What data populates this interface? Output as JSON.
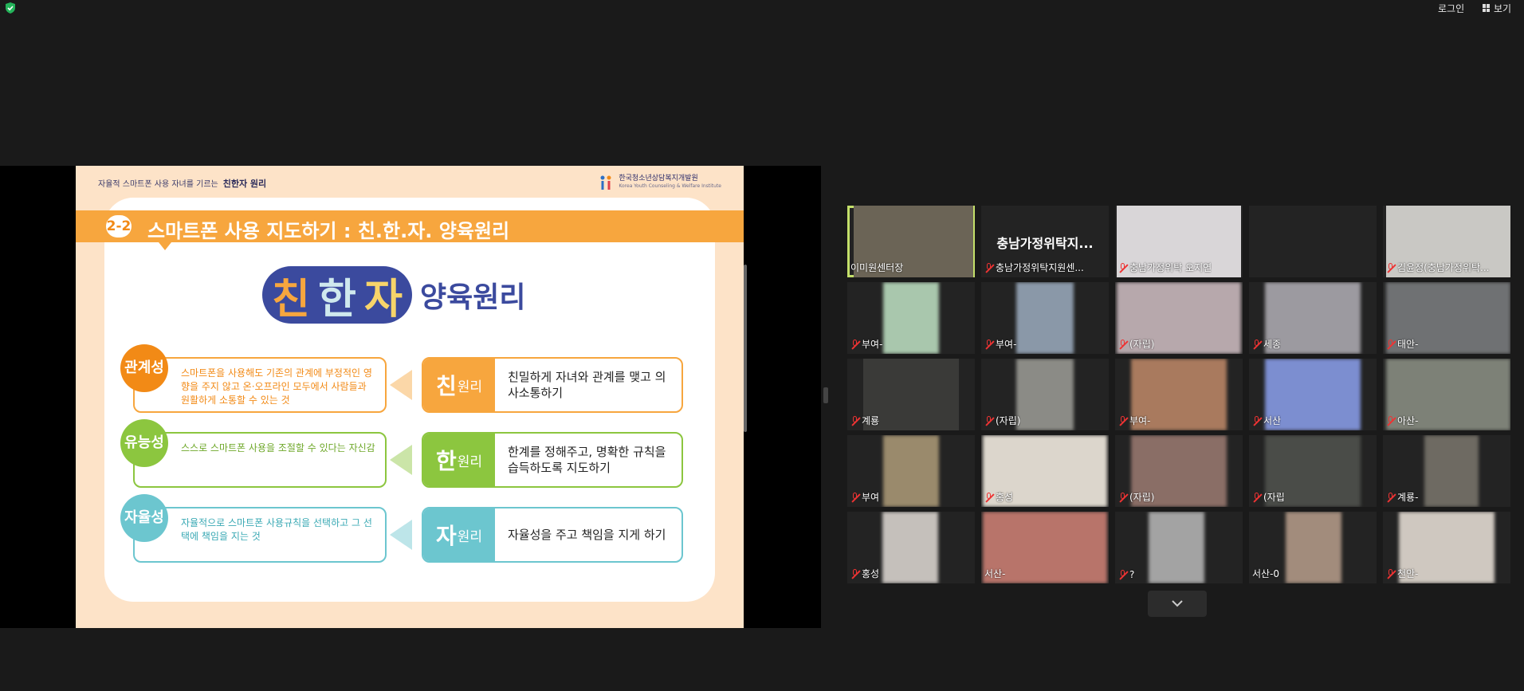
{
  "topbar": {
    "login_label": "로그인",
    "view_label": "보기"
  },
  "slide": {
    "subtitle": "자율적 스마트폰 사용 자녀를 기르는",
    "subtitle_bold": "친한자 원리",
    "institute": "한국청소년상담복지개발원",
    "institute_en": "Korea Youth Counseling & Welfare Institute",
    "section_no": "2-2",
    "title": "스마트폰 사용 지도하기 : 친.한.자. 양육원리",
    "hero_chars": [
      "친",
      "한",
      "자"
    ],
    "hero_suffix": "양육원리",
    "rows": [
      {
        "badge": "관계성",
        "text": "스마트폰을 사용해도 기존의 관계에 부정적인 영향을 주지 않고 온·오프라인 모두에서 사람들과 원활하게 소통할 수 있는 것",
        "tag_char": "친",
        "tag_word": "원리",
        "desc": "친밀하게 자녀와 관계를 맺고 의사소통하기"
      },
      {
        "badge": "유능성",
        "text": "스스로 스마트폰 사용을 조절할 수 있다는 자신감",
        "tag_char": "한",
        "tag_word": "원리",
        "desc": "한계를 정해주고, 명확한 규칙을 습득하도록 지도하기"
      },
      {
        "badge": "자율성",
        "text": "자율적으로 스마트폰 사용규칙을 선택하고 그 선택에 책임을 지는 것",
        "tag_char": "자",
        "tag_word": "원리",
        "desc": "자율성을 주고 책임을 지게 하기"
      }
    ]
  },
  "colors": {
    "orange": "#f7a63e",
    "green": "#8cc63f",
    "teal": "#6cc6cf",
    "navy": "#3b4a9e",
    "active_border": "#c4e06a",
    "mic_muted": "#e33333"
  },
  "participants": [
    {
      "name": "이미원센터장",
      "muted": false,
      "active": true
    },
    {
      "name": "충남가정위탁지원센...",
      "muted": true,
      "big": "충남가정위탁지..."
    },
    {
      "name": "충남가정위탁 오지연",
      "muted": true
    },
    {
      "name": "",
      "muted": false,
      "big": ""
    },
    {
      "name": "김윤정(충남가정위탁...",
      "muted": true
    },
    {
      "name": "부여-",
      "muted": true
    },
    {
      "name": "부여-",
      "muted": true
    },
    {
      "name": "(자립)",
      "muted": true
    },
    {
      "name": "세종",
      "muted": true
    },
    {
      "name": "태안-",
      "muted": true
    },
    {
      "name": "계룡",
      "muted": true
    },
    {
      "name": "(자립)",
      "muted": true
    },
    {
      "name": "부여-",
      "muted": true
    },
    {
      "name": "서산",
      "muted": true
    },
    {
      "name": "아산-",
      "muted": true
    },
    {
      "name": "부여",
      "muted": true
    },
    {
      "name": "홍성",
      "muted": true
    },
    {
      "name": "(자립)",
      "muted": true
    },
    {
      "name": "(자립",
      "muted": true
    },
    {
      "name": "계룡-",
      "muted": true
    },
    {
      "name": "홍성",
      "muted": true
    },
    {
      "name": "서산-",
      "muted": false
    },
    {
      "name": "?",
      "muted": true
    },
    {
      "name": "서산-0",
      "muted": false
    },
    {
      "name": "천안-",
      "muted": true
    }
  ]
}
